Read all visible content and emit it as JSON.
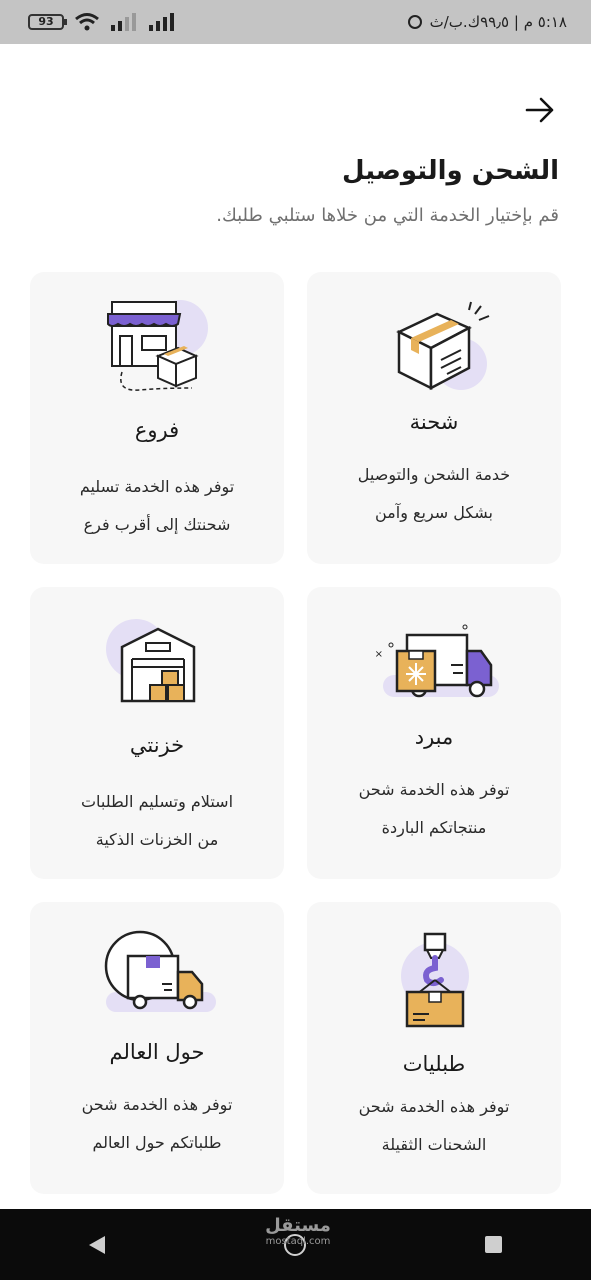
{
  "status_bar": {
    "battery": "93",
    "time": "٥:١٨ م | ٩٩٫٥ك.ب/ث"
  },
  "header": {
    "title": "الشحن والتوصيل",
    "subtitle": "قم بإختيار الخدمة التي من خلاها ستلبي طلبك."
  },
  "services": [
    {
      "title": "شحنة",
      "desc_line1": "خدمة الشحن والتوصيل",
      "desc_line2": "بشكل سريع وآمن",
      "icon": "package-box-icon"
    },
    {
      "title": "فروع",
      "desc_line1": "توفر هذه الخدمة تسليم",
      "desc_line2": "شحنتك إلى أقرب فرع",
      "icon": "branch-store-icon"
    },
    {
      "title": "مبرد",
      "desc_line1": "توفر هذه الخدمة شحن",
      "desc_line2": "منتجاتكم الباردة",
      "icon": "refrigerated-truck-icon"
    },
    {
      "title": "خزنتي",
      "desc_line1": "استلام وتسليم الطلبات",
      "desc_line2": "من الخزنات الذكية",
      "icon": "smart-locker-icon"
    },
    {
      "title": "طبليات",
      "desc_line1": "توفر هذه الخدمة شحن",
      "desc_line2": "الشحنات الثقيلة",
      "icon": "pallet-crane-icon"
    },
    {
      "title": "حول العالم",
      "desc_line1": "توفر هذه الخدمة شحن",
      "desc_line2": "طلباتكم حول العالم",
      "icon": "international-truck-icon"
    }
  ],
  "watermark": {
    "text": "مستقل",
    "sub": "mostaql.com"
  },
  "colors": {
    "accent_purple": "#7b61d1",
    "light_purple": "#e4dff5",
    "tape_orange": "#e8b25a",
    "card_bg": "#f7f7f7"
  }
}
